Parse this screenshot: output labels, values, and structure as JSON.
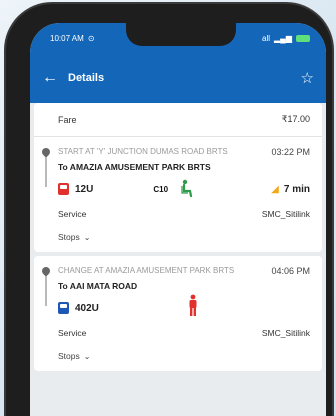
{
  "status_bar": {
    "time": "10:07 AM",
    "signal_text": "all",
    "battery_color": "#5fe07a"
  },
  "app_bar": {
    "title": "Details",
    "back_icon": "arrow-left-icon",
    "favorite_icon": "star-outline-icon",
    "color": "#1467b8"
  },
  "fare": {
    "label": "Fare",
    "value": "₹17.00"
  },
  "legs": [
    {
      "start": "Start at 'Y' JUNCTION DUMAS ROAD BRTS",
      "time": "03:22 PM",
      "destination": "To AMAZIA AMUSEMENT PARK BRTS",
      "route": "12U",
      "bus_color": "#e0312d",
      "seat_code": "C10",
      "seat_status": "seated",
      "wait": "7 min",
      "service_label": "Service",
      "service_value": "SMC_Sitilink",
      "stops_label": "Stops"
    },
    {
      "start": "Change at AMAZIA AMUSEMENT PARK BRTS",
      "time": "04:06 PM",
      "destination": "To AAI MATA ROAD",
      "route": "402U",
      "bus_color": "#1e57b5",
      "seat_status": "standing",
      "service_label": "Service",
      "service_value": "SMC_Sitilink",
      "stops_label": "Stops"
    }
  ]
}
